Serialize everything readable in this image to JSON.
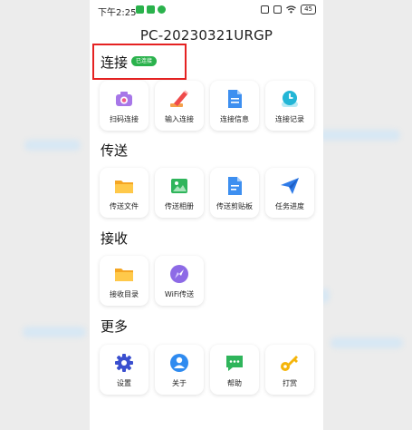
{
  "status_bar": {
    "time": "下午2:25",
    "battery": "45"
  },
  "device_name": "PC-20230321URGP",
  "sections": {
    "connect": {
      "title": "连接",
      "status_badge": "已连接",
      "items": [
        {
          "label": "扫码连接",
          "icon": "scan-camera-icon"
        },
        {
          "label": "输入连接",
          "icon": "pencil-icon"
        },
        {
          "label": "连接信息",
          "icon": "document-icon"
        },
        {
          "label": "连接记录",
          "icon": "clock-icon"
        }
      ]
    },
    "transfer": {
      "title": "传送",
      "items": [
        {
          "label": "传送文件",
          "icon": "folder-icon"
        },
        {
          "label": "传送相册",
          "icon": "photo-icon"
        },
        {
          "label": "传送剪贴板",
          "icon": "clipboard-icon"
        },
        {
          "label": "任务进度",
          "icon": "paper-plane-icon"
        }
      ]
    },
    "receive": {
      "title": "接收",
      "items": [
        {
          "label": "接收目录",
          "icon": "folder-icon"
        },
        {
          "label": "WiFi传送",
          "icon": "compass-icon"
        }
      ]
    },
    "more": {
      "title": "更多",
      "items": [
        {
          "label": "设置",
          "icon": "gear-icon"
        },
        {
          "label": "关于",
          "icon": "user-info-icon"
        },
        {
          "label": "帮助",
          "icon": "chat-icon"
        },
        {
          "label": "打赏",
          "icon": "key-icon"
        }
      ]
    }
  },
  "colors": {
    "connected_badge": "#2ab24c",
    "highlight_border": "#e52222"
  }
}
